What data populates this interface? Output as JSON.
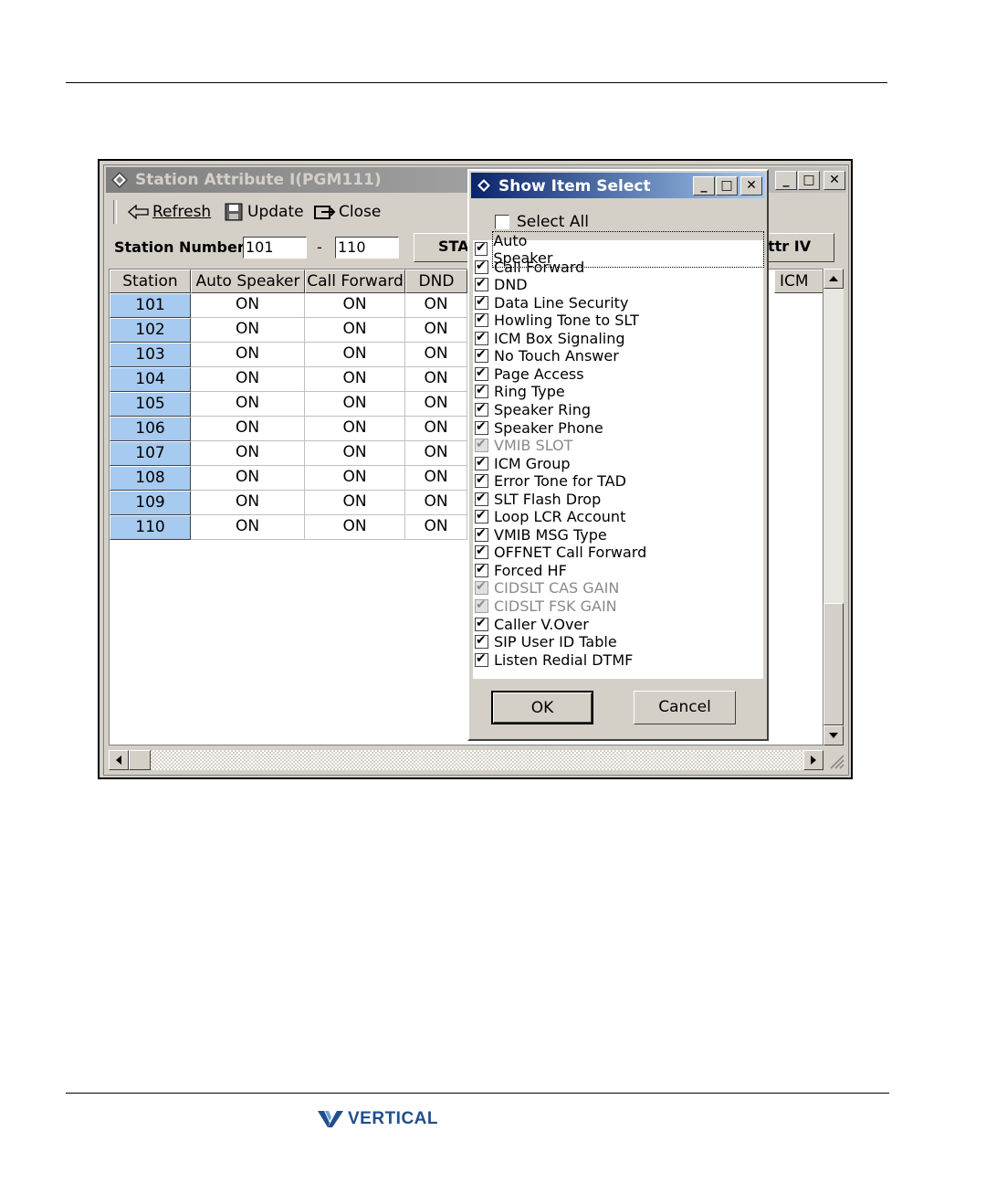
{
  "main_window": {
    "title": "Station Attribute I(PGM111)",
    "toolbar": {
      "refresh": "Refresh",
      "update": "Update",
      "close": "Close"
    },
    "station_number_label": "Station Number",
    "range_from": "101",
    "range_separator": "-",
    "range_to": "110",
    "tab_button_left": "STA",
    "tab_button_right": "ttr IV",
    "columns": [
      "Station",
      "Auto Speaker",
      "Call Forward",
      "DND",
      "ICM Bo"
    ],
    "rows": [
      {
        "station": "101",
        "auto_speaker": "ON",
        "call_forward": "ON",
        "dnd": "ON"
      },
      {
        "station": "102",
        "auto_speaker": "ON",
        "call_forward": "ON",
        "dnd": "ON"
      },
      {
        "station": "103",
        "auto_speaker": "ON",
        "call_forward": "ON",
        "dnd": "ON"
      },
      {
        "station": "104",
        "auto_speaker": "ON",
        "call_forward": "ON",
        "dnd": "ON"
      },
      {
        "station": "105",
        "auto_speaker": "ON",
        "call_forward": "ON",
        "dnd": "ON"
      },
      {
        "station": "106",
        "auto_speaker": "ON",
        "call_forward": "ON",
        "dnd": "ON"
      },
      {
        "station": "107",
        "auto_speaker": "ON",
        "call_forward": "ON",
        "dnd": "ON"
      },
      {
        "station": "108",
        "auto_speaker": "ON",
        "call_forward": "ON",
        "dnd": "ON"
      },
      {
        "station": "109",
        "auto_speaker": "ON",
        "call_forward": "ON",
        "dnd": "ON"
      },
      {
        "station": "110",
        "auto_speaker": "ON",
        "call_forward": "ON",
        "dnd": "ON"
      }
    ]
  },
  "dialog": {
    "title": "Show Item Select",
    "select_all_label": "Select All",
    "select_all_checked": false,
    "items": [
      {
        "label": "Auto Speaker",
        "checked": true,
        "disabled": false
      },
      {
        "label": "Call Forward",
        "checked": true,
        "disabled": false
      },
      {
        "label": "DND",
        "checked": true,
        "disabled": false
      },
      {
        "label": "Data Line Security",
        "checked": true,
        "disabled": false
      },
      {
        "label": "Howling Tone to SLT",
        "checked": true,
        "disabled": false
      },
      {
        "label": "ICM Box Signaling",
        "checked": true,
        "disabled": false
      },
      {
        "label": "No Touch Answer",
        "checked": true,
        "disabled": false
      },
      {
        "label": "Page Access",
        "checked": true,
        "disabled": false
      },
      {
        "label": "Ring Type",
        "checked": true,
        "disabled": false
      },
      {
        "label": "Speaker Ring",
        "checked": true,
        "disabled": false
      },
      {
        "label": "Speaker Phone",
        "checked": true,
        "disabled": false
      },
      {
        "label": "VMIB SLOT",
        "checked": true,
        "disabled": true
      },
      {
        "label": "ICM Group",
        "checked": true,
        "disabled": false
      },
      {
        "label": "Error Tone for TAD",
        "checked": true,
        "disabled": false
      },
      {
        "label": "SLT Flash Drop",
        "checked": true,
        "disabled": false
      },
      {
        "label": "Loop LCR Account",
        "checked": true,
        "disabled": false
      },
      {
        "label": "VMIB MSG Type",
        "checked": true,
        "disabled": false
      },
      {
        "label": "OFFNET Call Forward",
        "checked": true,
        "disabled": false
      },
      {
        "label": "Forced HF",
        "checked": true,
        "disabled": false
      },
      {
        "label": "CIDSLT CAS GAIN",
        "checked": true,
        "disabled": true
      },
      {
        "label": "CIDSLT FSK GAIN",
        "checked": true,
        "disabled": true
      },
      {
        "label": "Caller V.Over",
        "checked": true,
        "disabled": false
      },
      {
        "label": "SIP User ID Table",
        "checked": true,
        "disabled": false
      },
      {
        "label": "Listen Redial DTMF",
        "checked": true,
        "disabled": false
      }
    ],
    "ok_label": "OK",
    "cancel_label": "Cancel"
  },
  "footer": {
    "logo_text": "VERTICAL"
  },
  "colors": {
    "active_title": "#0a246a",
    "row_header": "#a6caf0",
    "logo": "#1f4e8c"
  }
}
